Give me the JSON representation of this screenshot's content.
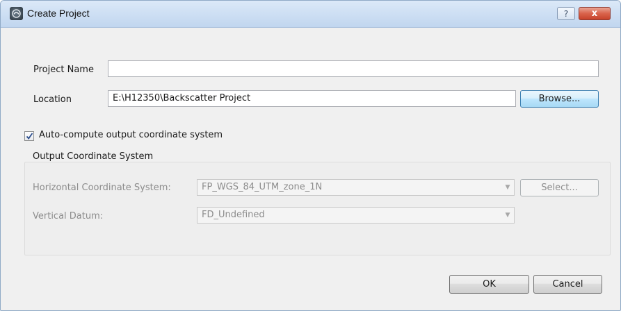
{
  "window": {
    "title": "Create Project",
    "help_label": "?",
    "close_label": "x"
  },
  "form": {
    "project_name_label": "Project Name",
    "project_name_value": "",
    "location_label": "Location",
    "location_value": "E:\\H12350\\Backscatter Project",
    "browse_label": "Browse..."
  },
  "auto_compute": {
    "label": "Auto-compute output coordinate system",
    "checked": true
  },
  "output_cs": {
    "heading": "Output Coordinate System",
    "horizontal_label": "Horizontal Coordinate System:",
    "horizontal_value": "FP_WGS_84_UTM_zone_1N",
    "select_label": "Select...",
    "vertical_label": "Vertical Datum:",
    "vertical_value": "FD_Undefined"
  },
  "footer": {
    "ok_label": "OK",
    "cancel_label": "Cancel"
  },
  "colors": {
    "titlebar": "#cfe0f4",
    "close_button": "#d9634c",
    "disabled_text": "#8c8c8c"
  }
}
